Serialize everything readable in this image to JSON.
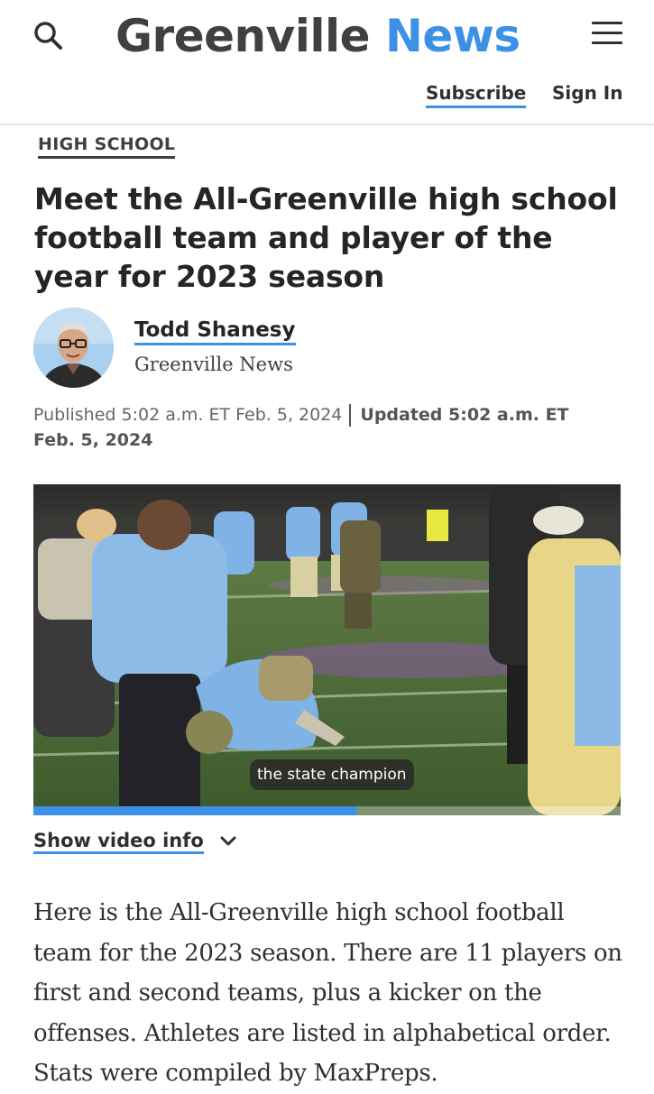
{
  "header": {
    "logo_part1": "Greenville",
    "logo_part2": "News",
    "subscribe_label": "Subscribe",
    "signin_label": "Sign In",
    "search_icon": "search-icon",
    "menu_icon": "hamburger-menu-icon"
  },
  "article": {
    "section": "HIGH SCHOOL",
    "headline": "Meet the All-Greenville high school football team and player of the year for 2023 season",
    "author": {
      "name": "Todd Shanesy",
      "organization": "Greenville News"
    },
    "published": "Published 5:02 a.m. ET Feb. 5, 2024",
    "updated": "Updated 5:02 a.m. ET Feb. 5, 2024",
    "video": {
      "caption": "the state champion",
      "progress": 0.55
    },
    "video_info_label": "Show video info",
    "body": "Here is the All-Greenville high school football team for the 2023 season. There are 11 players on first and second teams, plus a kicker on the offenses. Athletes are listed in alphabetical order. Stats were compiled by MaxPreps."
  },
  "colors": {
    "accent": "#3c91e6",
    "logo_dark": "#404040"
  }
}
